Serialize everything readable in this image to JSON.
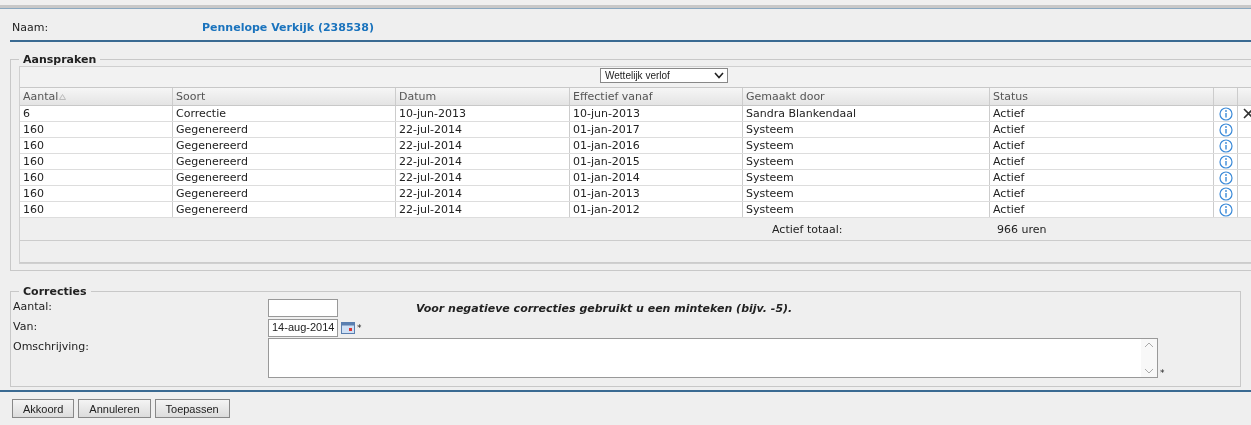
{
  "employee": {
    "label": "Naam:",
    "value": "Pennelope Verkijk (238538)"
  },
  "entitlements": {
    "legend": "Aanspraken",
    "filter": {
      "value": "Wettelijk verlof"
    },
    "columns": [
      {
        "label": "Aantal",
        "sorted": true
      },
      {
        "label": "Soort",
        "sorted": false
      },
      {
        "label": "Datum",
        "sorted": false
      },
      {
        "label": "Effectief vanaf",
        "sorted": false
      },
      {
        "label": "Gemaakt door",
        "sorted": false
      },
      {
        "label": "Status",
        "sorted": false
      }
    ],
    "rows": [
      {
        "cells": [
          "6",
          "Correctie",
          "10-jun-2013",
          "10-jun-2013",
          "Sandra Blankendaal",
          "Actief"
        ],
        "deletable": true
      },
      {
        "cells": [
          "160",
          "Gegenereerd",
          "22-jul-2014",
          "01-jan-2017",
          "Systeem",
          "Actief"
        ],
        "deletable": false
      },
      {
        "cells": [
          "160",
          "Gegenereerd",
          "22-jul-2014",
          "01-jan-2016",
          "Systeem",
          "Actief"
        ],
        "deletable": false
      },
      {
        "cells": [
          "160",
          "Gegenereerd",
          "22-jul-2014",
          "01-jan-2015",
          "Systeem",
          "Actief"
        ],
        "deletable": false
      },
      {
        "cells": [
          "160",
          "Gegenereerd",
          "22-jul-2014",
          "01-jan-2014",
          "Systeem",
          "Actief"
        ],
        "deletable": false
      },
      {
        "cells": [
          "160",
          "Gegenereerd",
          "22-jul-2014",
          "01-jan-2013",
          "Systeem",
          "Actief"
        ],
        "deletable": false
      },
      {
        "cells": [
          "160",
          "Gegenereerd",
          "22-jul-2014",
          "01-jan-2012",
          "Systeem",
          "Actief"
        ],
        "deletable": false
      }
    ],
    "total": {
      "label": "Actief totaal:",
      "value": "966 uren"
    }
  },
  "corrections": {
    "legend": "Correcties",
    "amount": {
      "label": "Aantal:",
      "hint": "Voor negatieve correcties gebruikt u een minteken (bijv. -5)."
    },
    "from": {
      "label": "Van:",
      "value": "14-aug-2014",
      "required_mark": "*"
    },
    "description": {
      "label": "Omschrijving:",
      "required_mark": "*"
    }
  },
  "buttons": [
    "Akkoord",
    "Annuleren",
    "Toepassen"
  ]
}
